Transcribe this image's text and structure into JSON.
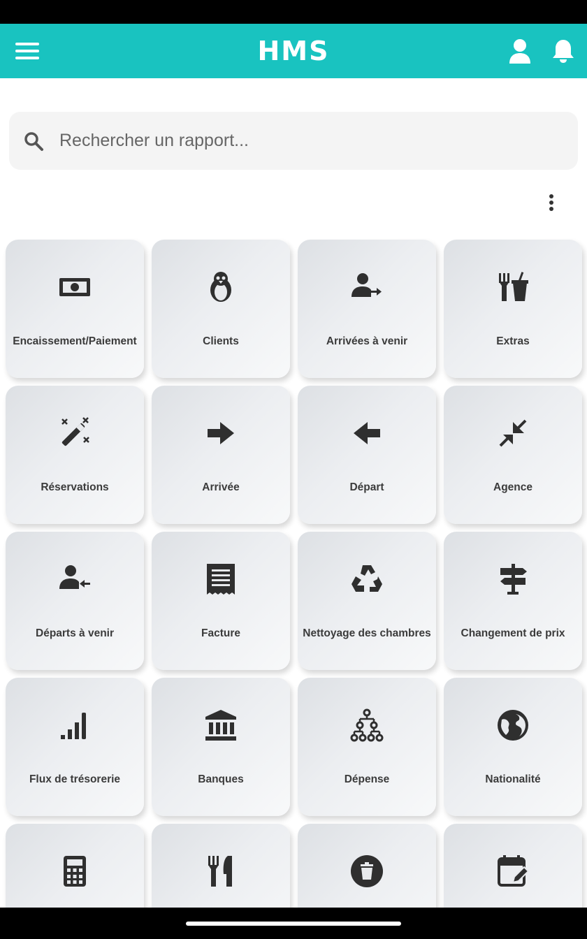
{
  "app": {
    "title": "HMS",
    "accent": "#19c3c0",
    "icon_color": "#2f2f2f"
  },
  "search": {
    "placeholder": "Rechercher un rapport...",
    "value": ""
  },
  "tiles": [
    {
      "label": "Encaissement/Paiement",
      "icon": "money-icon"
    },
    {
      "label": "Clients",
      "icon": "penguin-icon"
    },
    {
      "label": "Arrivées à venir",
      "icon": "person-arrow-right-icon"
    },
    {
      "label": "Extras",
      "icon": "fork-drink-icon"
    },
    {
      "label": "Réservations",
      "icon": "magic-wand-icon"
    },
    {
      "label": "Arrivée",
      "icon": "arrow-right-icon"
    },
    {
      "label": "Départ",
      "icon": "arrow-left-icon"
    },
    {
      "label": "Agence",
      "icon": "compress-arrows-icon"
    },
    {
      "label": "Départs à venir",
      "icon": "person-arrow-left-icon"
    },
    {
      "label": "Facture",
      "icon": "receipt-icon"
    },
    {
      "label": "Nettoyage des chambres",
      "icon": "recycle-icon"
    },
    {
      "label": "Changement de prix",
      "icon": "signpost-icon"
    },
    {
      "label": "Flux de trésorerie",
      "icon": "signal-bars-icon"
    },
    {
      "label": "Banques",
      "icon": "bank-icon"
    },
    {
      "label": "Dépense",
      "icon": "hierarchy-icon"
    },
    {
      "label": "Nationalité",
      "icon": "globe-icon"
    },
    {
      "label": "",
      "icon": "calculator-icon"
    },
    {
      "label": "",
      "icon": "restaurant-icon"
    },
    {
      "label": "",
      "icon": "trash-circle-icon"
    },
    {
      "label": "",
      "icon": "calendar-edit-icon"
    }
  ]
}
